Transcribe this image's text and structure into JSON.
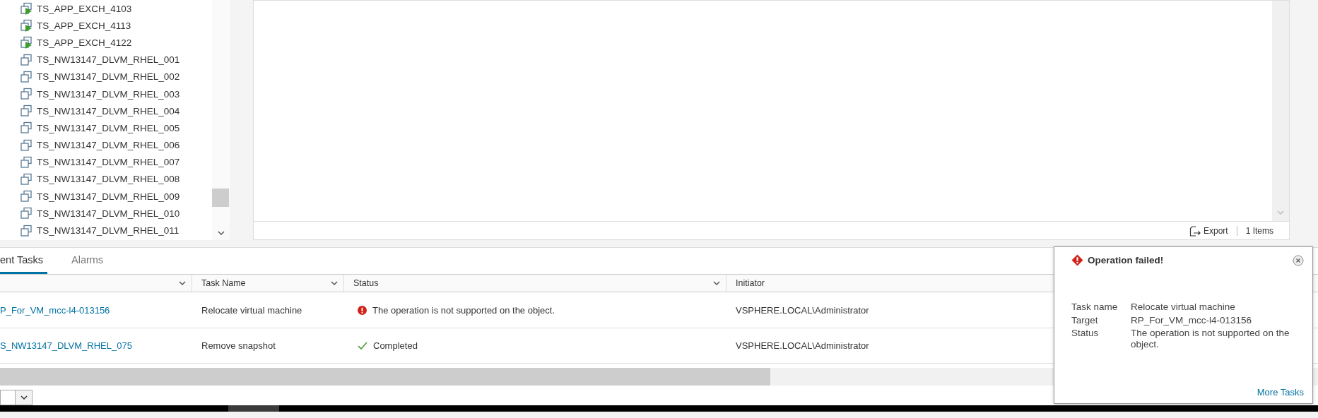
{
  "tree": {
    "items": [
      {
        "label": "TS_APP_EXCH_4103",
        "kind": "running"
      },
      {
        "label": "TS_APP_EXCH_4113",
        "kind": "running"
      },
      {
        "label": "TS_APP_EXCH_4122",
        "kind": "running"
      },
      {
        "label": "TS_NW13147_DLVM_RHEL_001",
        "kind": "vm"
      },
      {
        "label": "TS_NW13147_DLVM_RHEL_002",
        "kind": "vm"
      },
      {
        "label": "TS_NW13147_DLVM_RHEL_003",
        "kind": "vm"
      },
      {
        "label": "TS_NW13147_DLVM_RHEL_004",
        "kind": "vm"
      },
      {
        "label": "TS_NW13147_DLVM_RHEL_005",
        "kind": "vm"
      },
      {
        "label": "TS_NW13147_DLVM_RHEL_006",
        "kind": "vm"
      },
      {
        "label": "TS_NW13147_DLVM_RHEL_007",
        "kind": "vm"
      },
      {
        "label": "TS_NW13147_DLVM_RHEL_008",
        "kind": "vm"
      },
      {
        "label": "TS_NW13147_DLVM_RHEL_009",
        "kind": "vm"
      },
      {
        "label": "TS_NW13147_DLVM_RHEL_010",
        "kind": "vm"
      },
      {
        "label": "TS_NW13147_DLVM_RHEL_011",
        "kind": "vm"
      }
    ]
  },
  "main_panel": {
    "footer": {
      "export": "Export",
      "count": "1 Items"
    }
  },
  "bottom_panel": {
    "tabs": [
      {
        "label": "ent Tasks",
        "selected": true
      },
      {
        "label": "Alarms",
        "selected": false
      }
    ],
    "table": {
      "columns": [
        "Task Name",
        "Status",
        "Initiator"
      ],
      "rows": [
        {
          "target": "P_For_VM_mcc-l4-013156",
          "task_name": "Relocate virtual machine",
          "status": {
            "kind": "error",
            "text": "The operation is not supported on the object."
          },
          "initiator": "VSPHERE.LOCAL\\Administrator"
        },
        {
          "target": "S_NW13147_DLVM_RHEL_075",
          "task_name": "Remove snapshot",
          "status": {
            "kind": "success",
            "text": "Completed"
          },
          "initiator": "VSPHERE.LOCAL\\Administrator"
        }
      ]
    }
  },
  "notification": {
    "title": "Operation failed!",
    "details": [
      {
        "label": "Task name",
        "value": "Relocate virtual machine"
      },
      {
        "label": "Target",
        "value": "RP_For_VM_mcc-l4-013156"
      },
      {
        "label": "Status",
        "value": "The operation is not supported on the object."
      }
    ],
    "link": "More Tasks"
  }
}
